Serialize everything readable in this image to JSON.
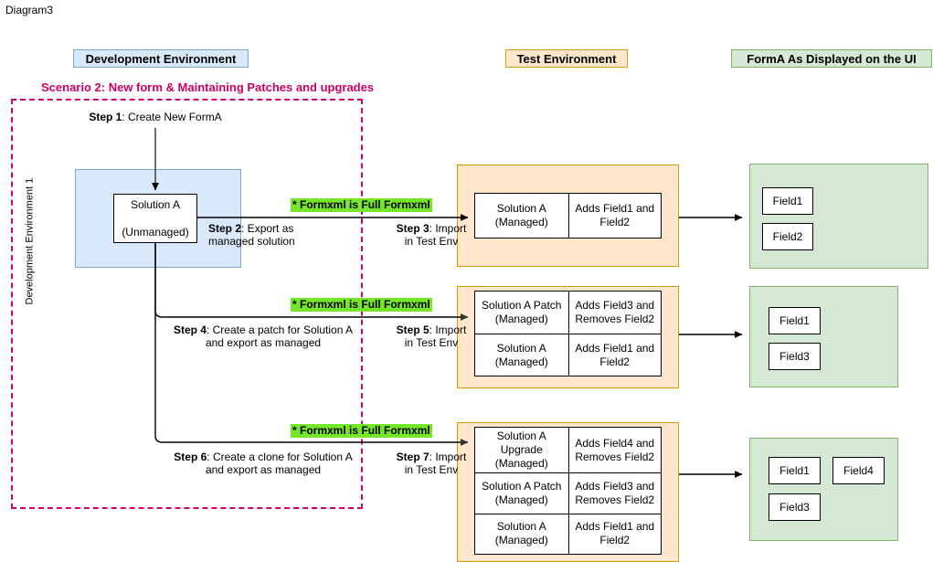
{
  "page": {
    "title": "Diagram3",
    "scenario_title": "Scenario 2: New form & Maintaining Patches and upgrades"
  },
  "legend": {
    "dev": "Development Environment",
    "test": "Test Environment",
    "ui": "FormA As Displayed on the UI"
  },
  "dev_env": {
    "vertical_label": "Development Environment 1",
    "solution": {
      "line1": "Solution A",
      "line2": "(Unmanaged)"
    }
  },
  "steps": {
    "step1_bold": "Step 1",
    "step1_rest": ": Create New FormA",
    "step2_bold": "Step 2",
    "step2_rest": ": Export as",
    "step2_line2": "managed solution",
    "step3_bold": "Step 3",
    "step3_rest": ": Import",
    "step3_line2": "in Test Env",
    "step4_bold": "Step 4",
    "step4_rest": ": Create a patch for Solution A",
    "step4_line2": "and export as managed",
    "step5_bold": "Step 5",
    "step5_rest": ": Import",
    "step5_line2": "in Test Env",
    "step6_bold": "Step 6",
    "step6_rest": ": Create a clone for Solution A",
    "step6_line2": "and export as managed",
    "step7_bold": "Step 7",
    "step7_rest": ": Import",
    "step7_line2": "in Test Env"
  },
  "notes": {
    "formxml": "* Formxml is Full Formxml"
  },
  "rows": [
    {
      "id": "row1",
      "solutions": [
        {
          "name_line1": "Solution A",
          "name_line2": "(Managed)",
          "effect_line1": "Adds Field1 and",
          "effect_line2": "Field2"
        }
      ],
      "fields": [
        "Field1",
        "Field2"
      ]
    },
    {
      "id": "row2",
      "solutions": [
        {
          "name_line1": "Solution A Patch",
          "name_line2": "(Managed)",
          "effect_line1": "Adds Field3 and",
          "effect_line2": "Removes Field2"
        },
        {
          "name_line1": "Solution A",
          "name_line2": "(Managed)",
          "effect_line1": "Adds Field1 and",
          "effect_line2": "Field2"
        }
      ],
      "fields": [
        "Field1",
        "Field3"
      ]
    },
    {
      "id": "row3",
      "solutions": [
        {
          "name_line1": "Solution A",
          "name_line1b": "Upgrade",
          "name_line2": "(Managed)",
          "effect_line1": "Adds Field4 and",
          "effect_line2": "Removes Field2"
        },
        {
          "name_line1": "Solution A Patch",
          "name_line2": "(Managed)",
          "effect_line1": "Adds Field3 and",
          "effect_line2": "Removes Field2"
        },
        {
          "name_line1": "Solution A",
          "name_line2": "(Managed)",
          "effect_line1": "Adds Field1 and",
          "effect_line2": "Field2"
        }
      ],
      "fields": [
        "Field1",
        "Field4",
        "Field3"
      ]
    }
  ],
  "colors": {
    "dev_fill": "#DAE8FC",
    "dev_stroke": "#7EA6D9",
    "test_fill": "#FFE6CC",
    "test_stroke": "#D79B00",
    "ui_fill": "#D5E8D4",
    "ui_stroke": "#82B366",
    "scenario_pink": "#CC0066",
    "dashed_pink": "#D6006B",
    "highlight_green": "#76E62B",
    "connector": "#000000"
  }
}
